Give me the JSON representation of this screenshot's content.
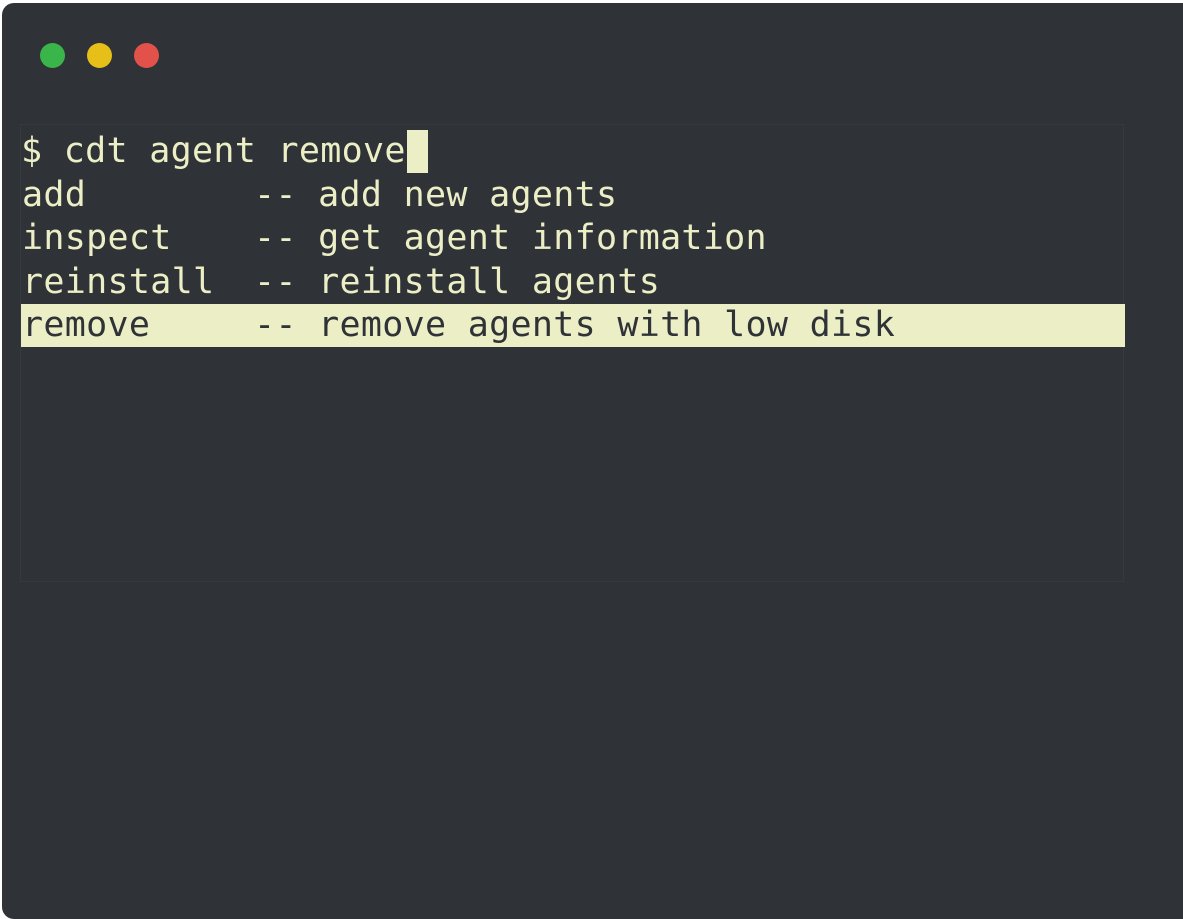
{
  "window": {
    "background": "#2f3337",
    "traffic_lights": [
      {
        "name": "green",
        "color": "#3ab54a"
      },
      {
        "name": "yellow",
        "color": "#e6c018"
      },
      {
        "name": "red",
        "color": "#e2524a"
      }
    ]
  },
  "terminal": {
    "prompt": "$ cdt agent remove",
    "text_color": "#ecefc6",
    "cursor_color": "#ecefc6",
    "selection_color": "#ecefc6",
    "completions": [
      {
        "command": "add",
        "description": "-- add new agents",
        "selected": false
      },
      {
        "command": "inspect",
        "description": "-- get agent information",
        "selected": false
      },
      {
        "command": "reinstall",
        "description": "-- reinstall agents",
        "selected": false
      },
      {
        "command": "remove",
        "description": "-- remove agents with low disk",
        "selected": true
      }
    ]
  }
}
